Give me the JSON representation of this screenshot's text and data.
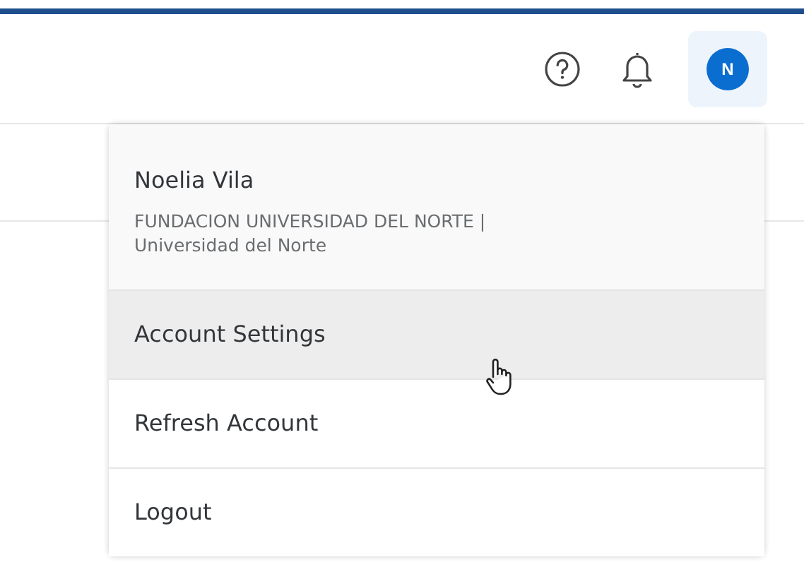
{
  "header": {
    "avatar_initial": "N"
  },
  "user_menu": {
    "name": "Noelia Vila",
    "organization": "FUNDACION UNIVERSIDAD DEL NORTE | Universidad del Norte",
    "items": [
      {
        "label": "Account Settings",
        "hovered": true
      },
      {
        "label": "Refresh Account",
        "hovered": false
      },
      {
        "label": "Logout",
        "hovered": false
      }
    ]
  }
}
